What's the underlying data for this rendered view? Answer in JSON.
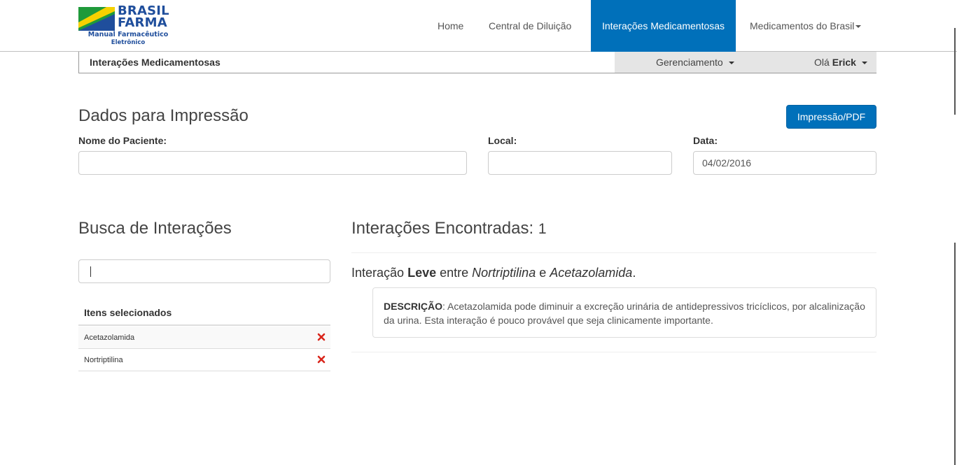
{
  "brand": {
    "line1": "BRASIL",
    "line2": "FARMA",
    "sub1": "Manual Farmacêutico",
    "sub2": "Eletrônico",
    "colors": {
      "blue": "#1f4e9c",
      "green": "#1f9a3a",
      "yellow": "#f5d100"
    }
  },
  "nav": {
    "items": [
      {
        "label": "Home"
      },
      {
        "label": "Central de Diluição"
      },
      {
        "label": "Interações Medicamentosas",
        "active": true
      },
      {
        "label": "Medicamentos do Brasil",
        "dropdown": true
      }
    ]
  },
  "subbar": {
    "title": "Interações Medicamentosas",
    "management": "Gerenciamento",
    "greeting": "Olá",
    "user": "Erick"
  },
  "print_section": {
    "heading": "Dados para Impressão",
    "button": "Impressão/PDF",
    "patient_label": "Nome do Paciente:",
    "patient_value": "",
    "local_label": "Local:",
    "local_value": "",
    "date_label": "Data:",
    "date_value": "04/02/2016"
  },
  "search_section": {
    "heading": "Busca de Interações",
    "query": "",
    "selected_heading": "Itens selecionados",
    "selected_items": [
      {
        "name": "Acetazolamida"
      },
      {
        "name": "Nortriptilina"
      }
    ]
  },
  "results": {
    "heading": "Interações Encontradas:",
    "count": "1",
    "interaction": {
      "prefix": "Interação",
      "severity": "Leve",
      "between": "entre",
      "drug_a": "Nortriptilina",
      "and": "e",
      "drug_b": "Acetazolamida",
      "end": "."
    },
    "description_label": "DESCRIÇÃO",
    "description_text": ": Acetazolamida pode diminuir a excreção urinária de antidepressivos tricíclicos, por alcalinização da urina. Esta interação é pouco provável que seja clinicamente importante."
  },
  "colors": {
    "primary": "#0070ba",
    "remove": "#d9261c"
  }
}
